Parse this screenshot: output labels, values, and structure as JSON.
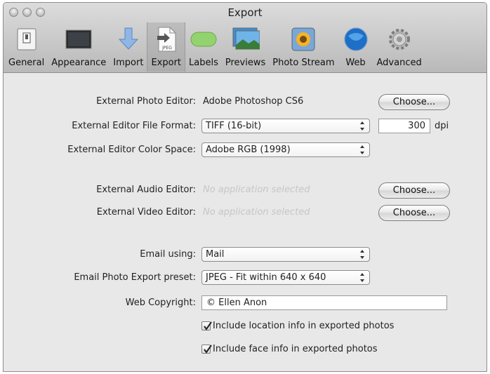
{
  "window": {
    "title": "Export"
  },
  "toolbar": {
    "items": [
      {
        "label": "General",
        "icon": "switch-icon"
      },
      {
        "label": "Appearance",
        "icon": "monitor-icon"
      },
      {
        "label": "Import",
        "icon": "import-arrow-icon"
      },
      {
        "label": "Export",
        "icon": "jpeg-export-icon",
        "selected": true
      },
      {
        "label": "Labels",
        "icon": "label-pill-icon"
      },
      {
        "label": "Previews",
        "icon": "previews-icon"
      },
      {
        "label": "Photo Stream",
        "icon": "photo-stream-icon"
      },
      {
        "label": "Web",
        "icon": "globe-icon"
      },
      {
        "label": "Advanced",
        "icon": "gear-icon"
      }
    ]
  },
  "form": {
    "photo_editor": {
      "label": "External Photo Editor:",
      "value": "Adobe Photoshop CS6",
      "button": "Choose..."
    },
    "file_format": {
      "label": "External Editor File Format:",
      "value": "TIFF (16-bit)",
      "dpi_value": "300",
      "dpi_unit": "dpi"
    },
    "color_space": {
      "label": "External Editor Color Space:",
      "value": "Adobe RGB (1998)"
    },
    "audio_editor": {
      "label": "External Audio Editor:",
      "value": "No application selected",
      "button": "Choose..."
    },
    "video_editor": {
      "label": "External Video Editor:",
      "value": "No application selected",
      "button": "Choose..."
    },
    "email_using": {
      "label": "Email using:",
      "value": "Mail"
    },
    "email_preset": {
      "label": "Email Photo Export preset:",
      "value": "JPEG - Fit within 640 x 640"
    },
    "web_copyright": {
      "label": "Web Copyright:",
      "value": "© Ellen Anon"
    },
    "include_location": {
      "label": "Include location info in exported photos",
      "checked": true
    },
    "include_face": {
      "label": "Include face info in exported photos",
      "checked": true
    }
  }
}
